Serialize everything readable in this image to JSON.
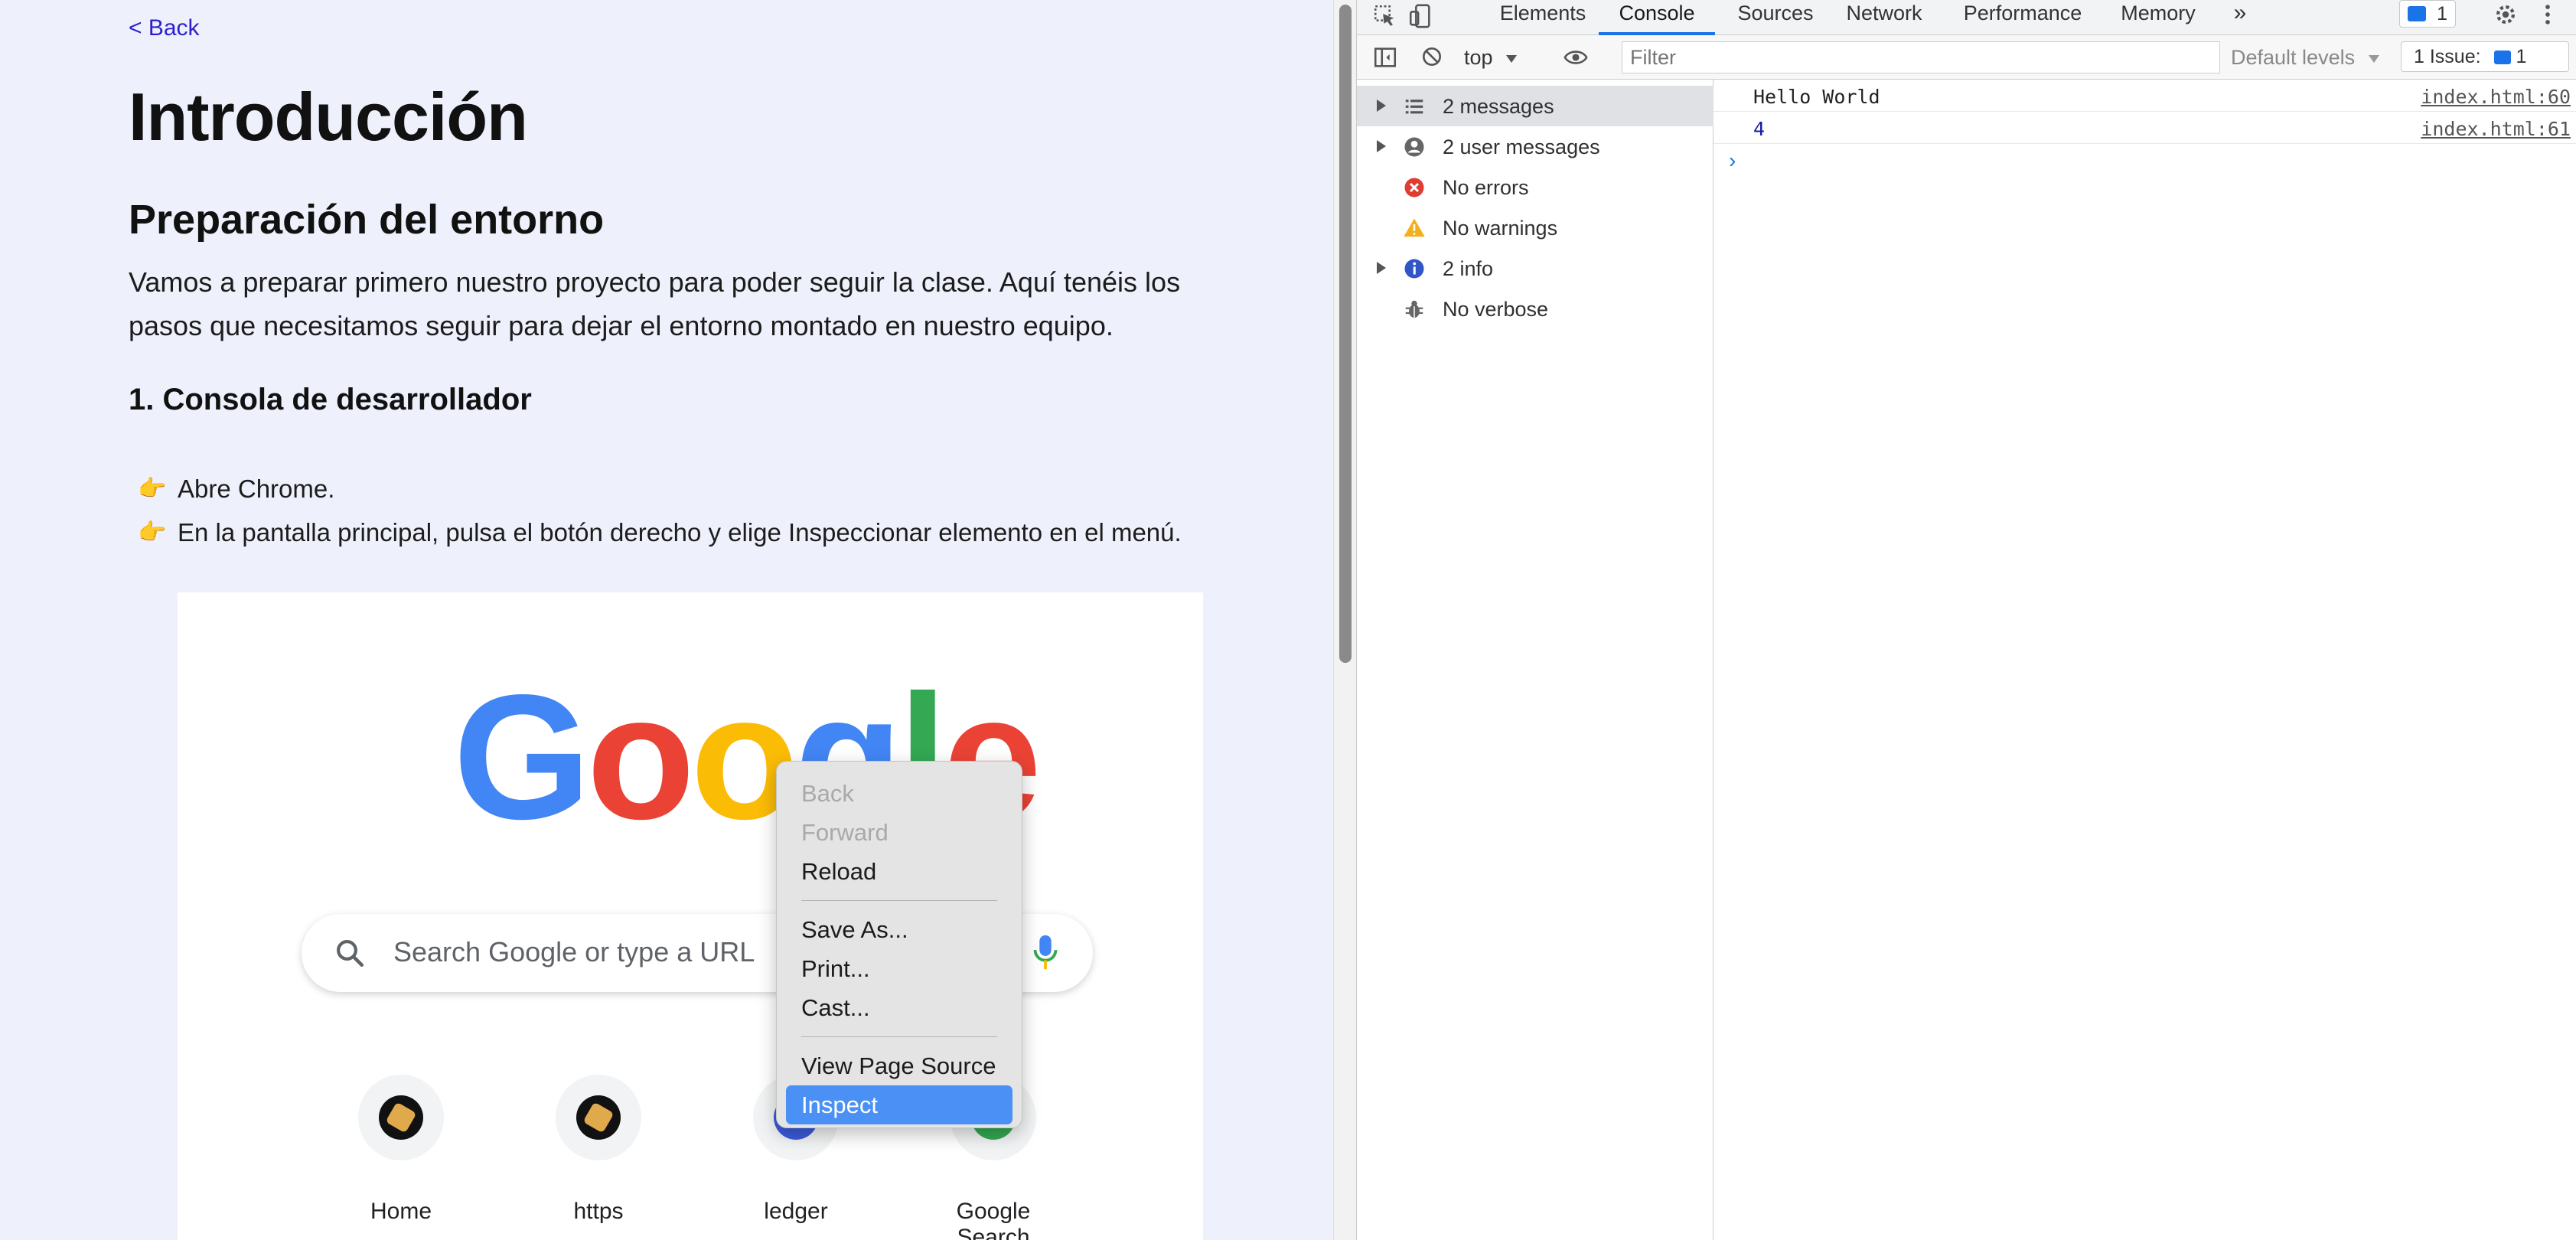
{
  "page": {
    "back_label": "< Back",
    "title": "Introducción",
    "section_title": "Preparación del entorno",
    "intro": "Vamos a preparar primero nuestro proyecto para poder seguir la clase. Aquí tenéis los pasos que necesitamos seguir para dejar el entorno montado en nuestro equipo.",
    "subsection_title": "1. Consola de desarrollador",
    "steps": [
      "Abre Chrome.",
      "En la pantalla principal, pulsa el botón derecho y elige Inspeccionar elemento en el menú."
    ],
    "step_icon": "pointing-hand-icon"
  },
  "screenshot": {
    "logo_letters": [
      "G",
      "o",
      "o",
      "g",
      "l",
      "e"
    ],
    "logo_colors": [
      "#4285f4",
      "#ea4335",
      "#fbbc05",
      "#4285f4",
      "#34a853",
      "#ea4335"
    ],
    "search_placeholder": "Search Google or type a URL",
    "shortcuts": [
      "Home",
      "https",
      "ledger",
      "Google Search"
    ],
    "context_menu": {
      "items": [
        {
          "label": "Back",
          "disabled": true
        },
        {
          "label": "Forward",
          "disabled": true
        },
        {
          "label": "Reload",
          "disabled": false
        },
        {
          "label": "Save As...",
          "disabled": false
        },
        {
          "label": "Print...",
          "disabled": false
        },
        {
          "label": "Cast...",
          "disabled": false
        },
        {
          "label": "View Page Source",
          "disabled": false
        },
        {
          "label": "Inspect",
          "disabled": false,
          "active": true
        }
      ]
    }
  },
  "devtools": {
    "tabs": [
      "Elements",
      "Console",
      "Sources",
      "Network",
      "Performance",
      "Memory"
    ],
    "active_tab": "Console",
    "more_tabs": "»",
    "message_badge": "1",
    "context_selector": "top",
    "filter_placeholder": "Filter",
    "levels_label": "Default levels",
    "issues_label": "1 Issue:",
    "issues_count": "1",
    "sidebar": [
      {
        "label": "2 messages",
        "icon": "list-icon",
        "expandable": true,
        "selected": true
      },
      {
        "label": "2 user messages",
        "icon": "user-icon",
        "expandable": true
      },
      {
        "label": "No errors",
        "icon": "error-icon",
        "expandable": false
      },
      {
        "label": "No warnings",
        "icon": "warning-icon",
        "expandable": false
      },
      {
        "label": "2 info",
        "icon": "info-icon",
        "expandable": true
      },
      {
        "label": "No verbose",
        "icon": "bug-icon",
        "expandable": false
      }
    ],
    "logs": [
      {
        "message": "Hello World",
        "source": "index.html:60",
        "numeric": false
      },
      {
        "message": "4",
        "source": "index.html:61",
        "numeric": true
      }
    ],
    "prompt_symbol": "›"
  }
}
